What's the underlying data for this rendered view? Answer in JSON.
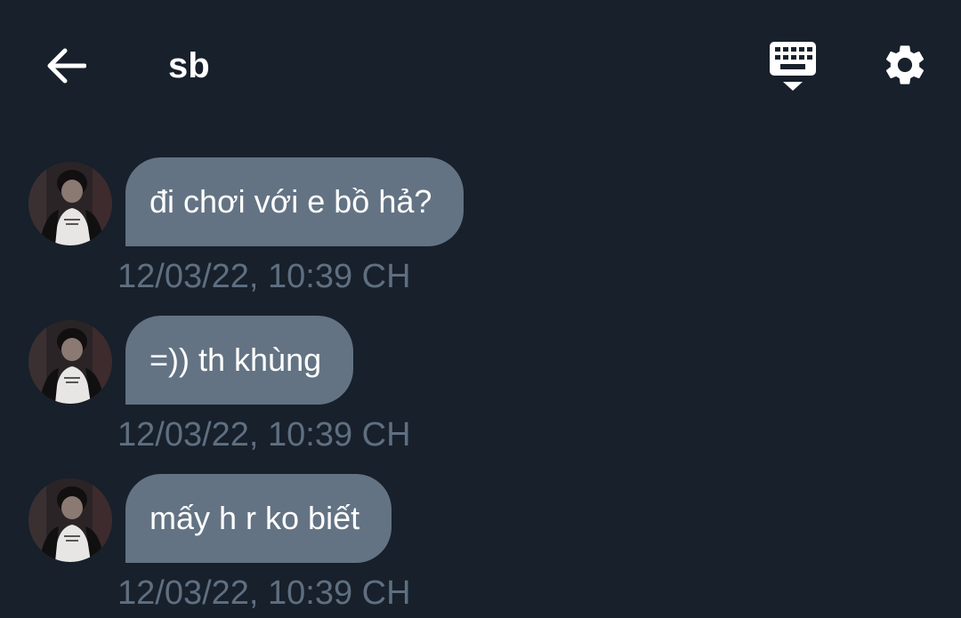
{
  "header": {
    "title": "sb",
    "back_icon": "arrow-left-icon",
    "keyboard_icon": "keyboard-hide-icon",
    "settings_icon": "gear-icon"
  },
  "colors": {
    "background": "#17202b",
    "bubble": "#637383",
    "timestamp": "#5f6f80",
    "text": "#ffffff"
  },
  "messages": [
    {
      "text": "đi chơi với e bồ hả?",
      "time": "12/03/22, 10:39 CH"
    },
    {
      "text": "=)) th khùng",
      "time": "12/03/22, 10:39 CH"
    },
    {
      "text": "mấy h r ko biết",
      "time": "12/03/22, 10:39 CH"
    }
  ]
}
